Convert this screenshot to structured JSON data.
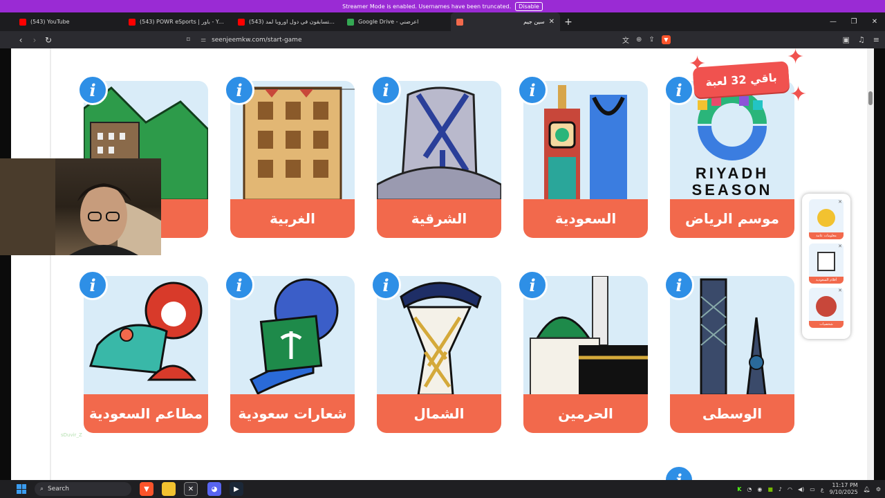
{
  "banner": {
    "text": "Streamer Mode is enabled. Usernames have been truncated.",
    "disable_label": "Disable"
  },
  "tabs": [
    {
      "title": "(543) YouTube",
      "favicon": "youtube-icon",
      "color": "#ff0000"
    },
    {
      "title": "(543) POWR eSports | باور - YouTube",
      "favicon": "youtube-icon",
      "color": "#ff0000"
    },
    {
      "title": "(543) باور يتسابقون في دول اوروبا لمد...",
      "favicon": "youtube-icon",
      "color": "#ff0000"
    },
    {
      "title": "Google Drive - اعرضني",
      "favicon": "google-drive-icon",
      "color": "#34a853"
    },
    {
      "title": "سين جيم",
      "favicon": "seenjeem-icon",
      "color": "#f2694c",
      "active": true
    }
  ],
  "address": {
    "url": "seenjeemkw.com/start-game"
  },
  "counter_label": "باقي 32 لعبة",
  "cards_row1": [
    {
      "label": "موسم الرياض",
      "art": "riyadh-season"
    },
    {
      "label": "السعودية",
      "art": "saudi"
    },
    {
      "label": "الشرقية",
      "art": "eastern"
    },
    {
      "label": "الغربية",
      "art": "western"
    },
    {
      "label": "ال",
      "art": "mountains"
    }
  ],
  "cards_row2": [
    {
      "label": "الوسطى",
      "art": "central"
    },
    {
      "label": "الحرمين",
      "art": "haramain"
    },
    {
      "label": "الشمال",
      "art": "north"
    },
    {
      "label": "شعارات سعودية",
      "art": "emblems"
    },
    {
      "label": "مطاعم السعودية",
      "art": "restaurants"
    }
  ],
  "riyadh_logo": {
    "line1": "RIYADH",
    "line2": "SEASON"
  },
  "side_panel": [
    {
      "caption": "معلومات عامة"
    },
    {
      "caption": "أفلام السعودية"
    },
    {
      "caption": "شخصيات"
    }
  ],
  "watermark": "sDuvir_Z",
  "taskbar": {
    "search_label": "Search",
    "time": "11:17 PM",
    "date": "9/10/2025",
    "lang": "ع"
  },
  "colors": {
    "accent": "#f2694c",
    "info": "#2e8fe6",
    "banner": "#9a2bd4",
    "card_bg": "#d9ecf8"
  }
}
